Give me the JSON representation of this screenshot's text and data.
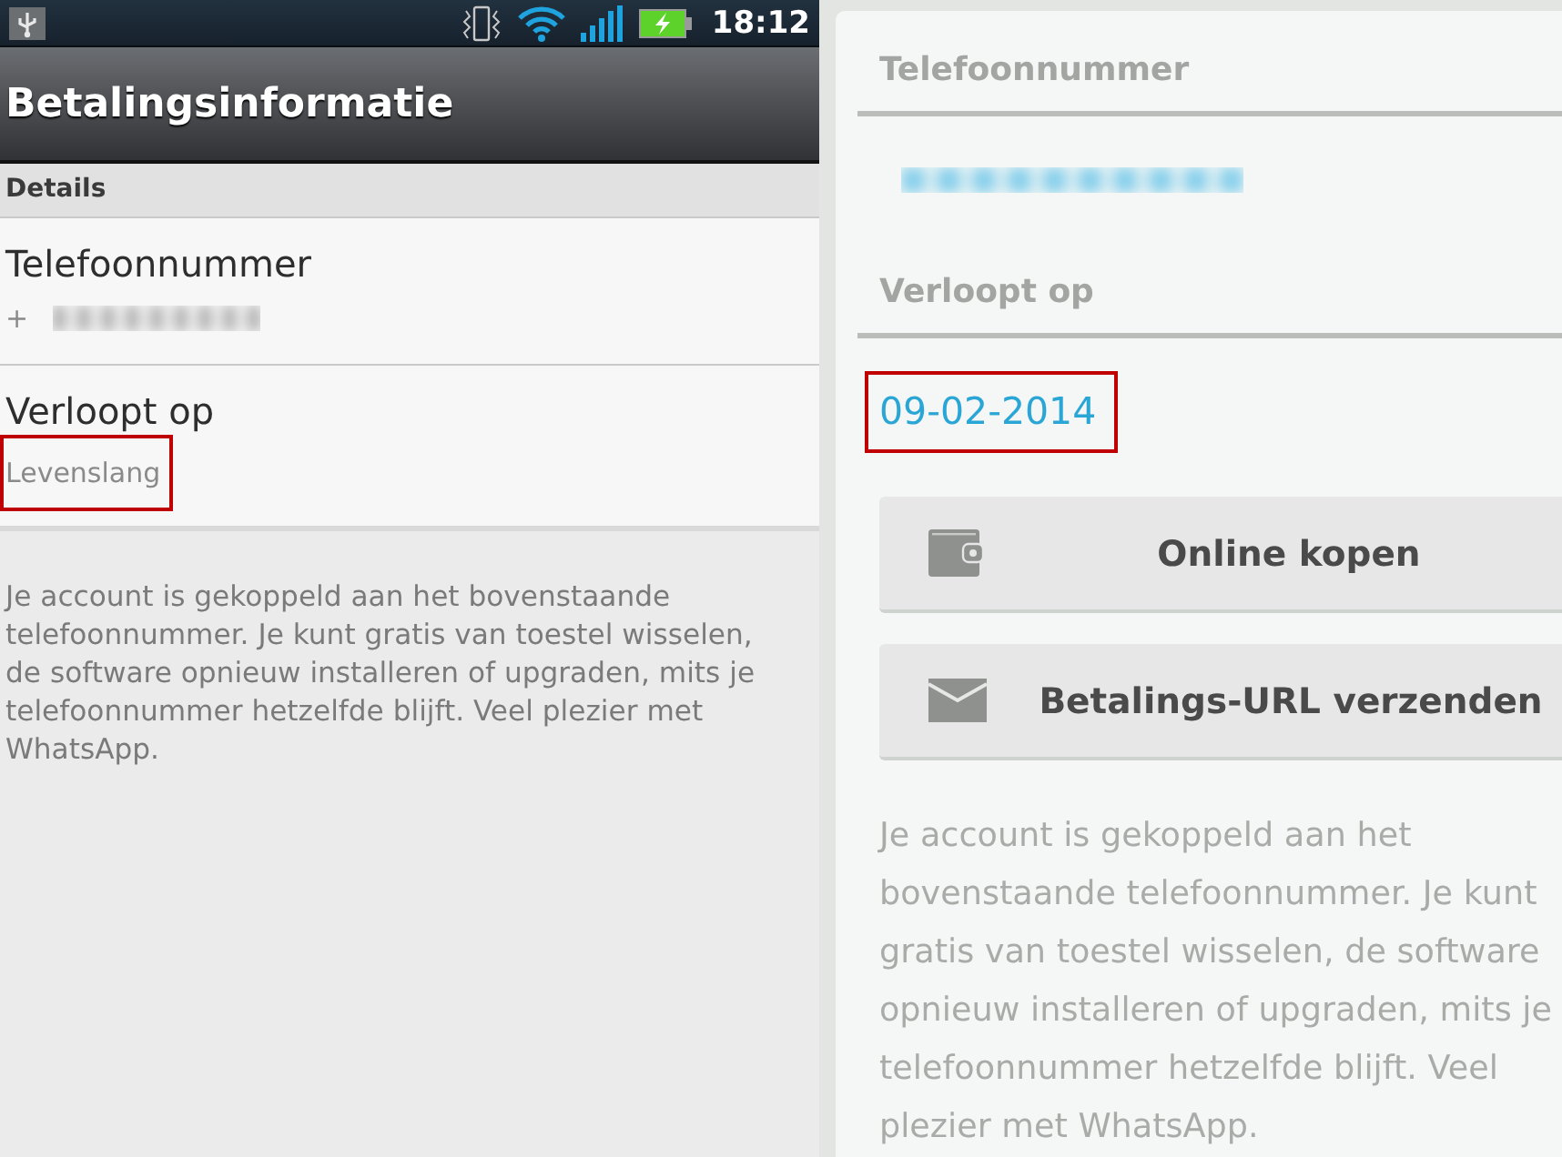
{
  "left_screen": {
    "status_bar": {
      "time": "18:12"
    },
    "title": "Betalingsinformatie",
    "section": "Details",
    "fields": [
      {
        "label": "Telefoonnummer",
        "value": "+",
        "blurred": true,
        "highlighted": false
      },
      {
        "label": "Verloopt op",
        "value": "Levenslang",
        "blurred": false,
        "highlighted": true
      }
    ],
    "description": "Je account is gekoppeld aan het bovenstaande telefoonnummer. Je kunt gratis van toestel wisselen, de software opnieuw installeren of upgraden, mits je telefoonnummer hetzelfde blijft. Veel plezier met WhatsApp."
  },
  "right_screen": {
    "fields": [
      {
        "label": "Telefoonnummer",
        "blurred": true,
        "highlighted": false
      },
      {
        "label": "Verloopt op",
        "value": "09-02-2014",
        "blurred": false,
        "highlighted": true
      }
    ],
    "buttons": [
      {
        "label": "Online kopen"
      },
      {
        "label": "Betalings-URL verzenden"
      }
    ],
    "description": "Je account is gekoppeld aan het bovenstaande telefoonnummer. Je kunt gratis van toestel wisselen, de software opnieuw installeren of upgraden, mits je telefoonnummer hetzelfde blijft. Veel plezier met WhatsApp."
  }
}
